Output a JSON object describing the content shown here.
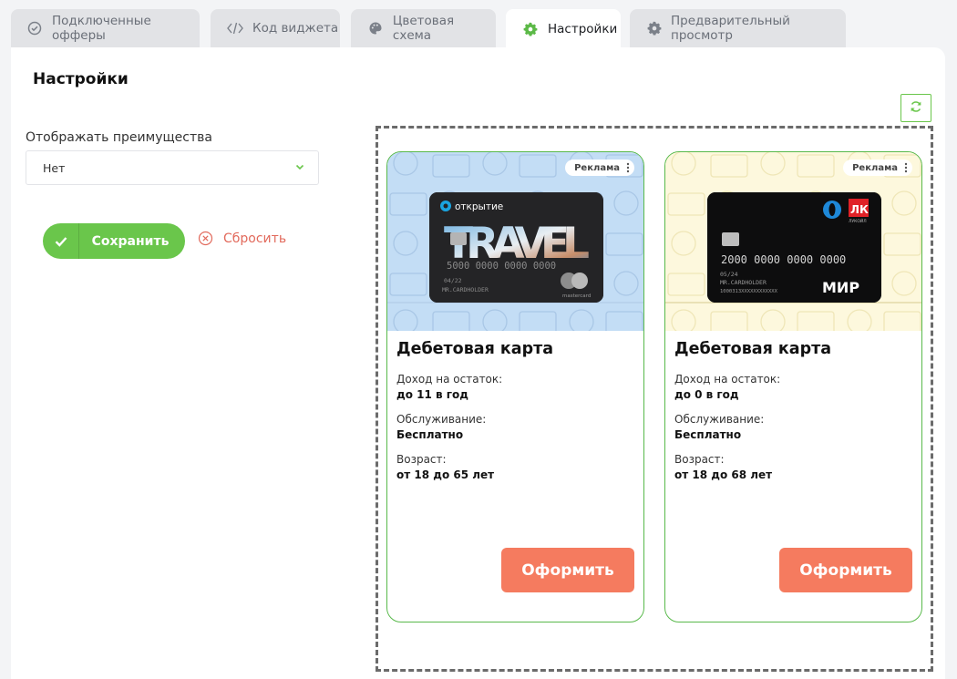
{
  "tabs": [
    {
      "label": "Подключенные офферы",
      "icon": "check-circle-icon"
    },
    {
      "label": "Код виджета",
      "icon": "code-icon"
    },
    {
      "label": "Цветовая схема",
      "icon": "palette-icon"
    },
    {
      "label": "Настройки",
      "icon": "gear-icon",
      "active": true
    },
    {
      "label": "Предварительный просмотр",
      "icon": "gear-icon"
    }
  ],
  "page": {
    "title": "Настройки"
  },
  "settings": {
    "benefits_label": "Отображать преимущества",
    "benefits_value": "Нет",
    "save_label": "Сохранить",
    "reset_label": "Сбросить"
  },
  "colors": {
    "accent": "#6ac64b",
    "cta": "#f57b5f",
    "reset": "#e26a5c"
  },
  "offers": [
    {
      "ad_label": "Реклама",
      "banner_bg": "#c3ddf5",
      "card_brand": "открытие",
      "card_word": "TRAVEL",
      "card_number": "5000 0000 0000 0000",
      "card_expiry": "04/22",
      "card_holder": "MR.CARDHOLDER",
      "card_network": "mastercard",
      "title": "Дебетовая карта",
      "income_label": "Доход на остаток:",
      "income_value": "до 11 в год",
      "service_label": "Обслуживание:",
      "service_value": "Бесплатно",
      "age_label": "Возраст:",
      "age_value": "от 18 до 65 лет",
      "apply_label": "Оформить"
    },
    {
      "ad_label": "Реклама",
      "banner_bg": "#fdf8dd",
      "card_brand": "ЛУКОЙЛ",
      "card_number": "2000 0000 0000 0000",
      "card_expiry": "05/24",
      "card_holder": "MR.CARDHOLDER",
      "card_code": "1000313XXXXXXXXXXXX",
      "card_network": "МИР",
      "title": "Дебетовая карта",
      "income_label": "Доход на остаток:",
      "income_value": "до 0 в год",
      "service_label": "Обслуживание:",
      "service_value": "Бесплатно",
      "age_label": "Возраст:",
      "age_value": "от 18 до 68 лет",
      "apply_label": "Оформить"
    }
  ]
}
